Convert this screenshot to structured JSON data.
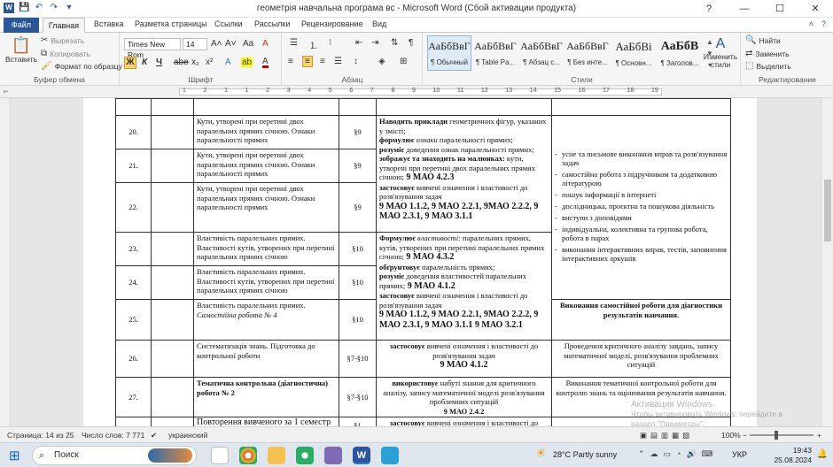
{
  "window": {
    "title": "геометрія навчальна програма вс  -  Microsoft Word (Сбой активации продукта)",
    "controls": [
      "?",
      "—",
      "☐",
      "✕"
    ]
  },
  "tabs": [
    "Файл",
    "Главная",
    "Вставка",
    "Разметка страницы",
    "Ссылки",
    "Рассылки",
    "Рецензирование",
    "Вид"
  ],
  "ribbon": {
    "clipboard": {
      "paste": "Вставить",
      "cut": "Вырезать",
      "copy": "Копировать",
      "format_painter": "Формат по образцу",
      "label": "Буфер обмена"
    },
    "font": {
      "name": "Times New Rom",
      "size": "14",
      "label": "Шрифт",
      "bold": "Ж",
      "italic": "К",
      "underline": "Ч",
      "strike": "abe",
      "sub": "x₂",
      "sup": "x²",
      "grow": "A˄",
      "shrink": "A˅",
      "change_case": "Aa",
      "clear": "A",
      "highlight": "ab",
      "color": "A"
    },
    "paragraph": {
      "label": "Абзац",
      "pilcrow": "¶"
    },
    "styles": {
      "label": "Стили",
      "items": [
        {
          "sample": "АаБбВвГ",
          "name": "¶ Обычный"
        },
        {
          "sample": "АаБбВвГ",
          "name": "¶ Table Pa..."
        },
        {
          "sample": "АаБбВвГ",
          "name": "¶ Абзац с..."
        },
        {
          "sample": "АаБбВвГ",
          "name": "¶ Без инте..."
        },
        {
          "sample": "АаБбВі",
          "name": "¶ Основн..."
        },
        {
          "sample": "АаБбВ",
          "name": "¶ Заголов..."
        }
      ],
      "change": "Изменить стили"
    },
    "editing": {
      "label": "Редактирование",
      "find": "Найти",
      "replace": "Заменить",
      "select": "Выделить"
    }
  },
  "ruler": {
    "marks": [
      "1",
      "2",
      "1",
      "1",
      "2",
      "3",
      "4",
      "5",
      "6",
      "7",
      "8",
      "9",
      "10",
      "11",
      "12",
      "13",
      "14",
      "15",
      "16",
      "17",
      "18",
      "19"
    ]
  },
  "table": {
    "rows": [
      {
        "num": "",
        "topic": "",
        "par": "",
        "content": "",
        "result": ""
      },
      {
        "num": "20.",
        "topic": "Кути, утворені при перетині двох паралельних прямих січною. Ознаки паралельності прямих",
        "par": "§9"
      },
      {
        "num": "21.",
        "topic": "Кути, утворені при перетині двох паралельних прямих січною. Ознаки паралельності прямих",
        "par": "§9"
      },
      {
        "num": "22.",
        "topic": "Кути, утворені при перетині двох паралельних прямих січною. Ознаки паралельності прямих",
        "par": "§9"
      },
      {
        "num": "23.",
        "topic": "Властивість паралельних прямих. Властивості кутів, утворених при перетині паралельних прямих січною",
        "par": "§10"
      },
      {
        "num": "24.",
        "topic": "Властивість паралельних прямих. Властивості кутів, утворених при перетині паралельних прямих січною",
        "par": "§10"
      },
      {
        "num": "25.",
        "topic": "Властивість паралельних прямих.",
        "topic_italic": "Самостійна робота № 4",
        "par": "§10",
        "result": "Виконання самостійної роботи для діагностики результатів навчання."
      },
      {
        "num": "26.",
        "topic": "Систематизація знань. Підготовка до контрольної роботи",
        "par": "§7-§10",
        "content_bold": "застосовує",
        "content": " вивчені означення і властивості до розв'язування задач",
        "content_code": "9 МАО 4.1.2",
        "result": "Проведення критичного аналізу завдань, запису математичної моделі, розв'язування проблемних ситуацій"
      },
      {
        "num": "27.",
        "topic": "Тематична контрольна (діагностична) робота № 2",
        "par": "§7-§10",
        "content_bold": "використовує",
        "content": " набуті знання для критичного аналізу, запису математичної моделі розв'язування проблемних ситуацій",
        "content_code": "9 МАО 2.4.2",
        "result": "Виконання тематичної контрольної роботи для контролю знань та оцінювання результатів навчання."
      },
      {
        "num": "",
        "topic": "Повторення вивченого за 1 семестр",
        "par": "§1",
        "content_bold": "застосовує",
        "content": " вивчені означення і властивості до"
      }
    ],
    "block1": {
      "l1b": "Наводить приклади",
      "l1": " геометричних фігур, указаних у змісті;",
      "l2b": "формулює",
      "l2i": " ознаки",
      "l2": " паралельності прямих;",
      "l3b": "розуміє",
      "l3": " доведення ознак паралельності прямих;",
      "l4b": "зображує та знаходить на малюнках:",
      "l4": " кути, утворені при перетині двох паралельних прямих січною;",
      "l4c": " 9 МАО 4.2.3",
      "l5b": "застосовує",
      "l5": " вивчені означення і властивості до розв'язування задач",
      "l5c": "9 МАО 1.1.2,  9 МАО 2.2.1, 9МАО 2.2.2, 9 МАО 2.3.1, 9 МАО 3.1.1"
    },
    "block2": {
      "l1b": "Формулює",
      "l1i": " властивості:",
      "l1": " паралельних прямих, кутів, утворених при перетині паралельних прямих січною;",
      "l1c": " 9 МАО 4.3.2",
      "l2b": "обґрунтовує",
      "l2": " паралельність прямих;",
      "l3b": "розуміє",
      "l3": " доведення властивостей паралельних прямих;",
      "l3c": " 9 МАО 4.1.2",
      "l4b": "застосовує",
      "l4": " вивчені означення і властивості до розв'язування задач",
      "l4c": "9 МАО 1.1.2,  9 МАО 2.2.1, 9МАО 2.2.2, 9 МАО 2.3.1, 9 МАО 3.1.1 9 МАО 3.2.1"
    },
    "activities": [
      "усне та письмове виконання вправ та розв'язування задач",
      "самостійна робота з підручником та додатковою літературою",
      "пошук інформації в інтернеті",
      "дослідницька, проєктна та пошукова діяльність",
      "виступи з доповідями",
      "індивідуальна, колективна та групова робота, робота в парах",
      "виконання інтерактивних вправ, тестів, заповнення інтерактивних аркушів"
    ]
  },
  "status": {
    "page": "Страница: 14 из 25",
    "words": "Число слов: 7 771",
    "lang": "украинский",
    "zoom": "100%",
    "zoom_value": 1.0
  },
  "watermark": {
    "line1": "Активация Windows",
    "line2": "Чтобы активировать Windows, перейдите в",
    "line3": "раздел \"Параметры\"."
  },
  "taskbar": {
    "search": "Поиск",
    "weather": "28°C  Partly sunny",
    "lang": "УКР",
    "time": "19:43",
    "date": "25.08.2024"
  }
}
